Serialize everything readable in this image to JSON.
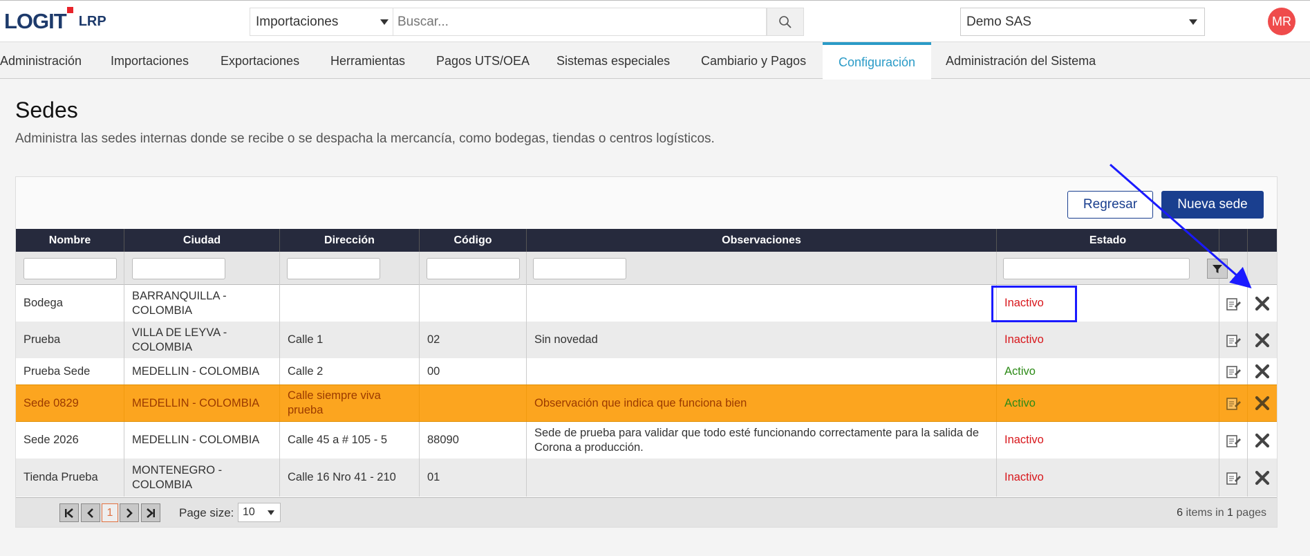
{
  "header": {
    "logo_text": "LOGIT",
    "logo_suffix": "LRP",
    "module_selected": "Importaciones",
    "search_placeholder": "Buscar...",
    "company_selected": "Demo SAS",
    "avatar_initials": "MR"
  },
  "nav": {
    "items": [
      {
        "label": "Administración"
      },
      {
        "label": "Importaciones"
      },
      {
        "label": "Exportaciones"
      },
      {
        "label": "Herramientas"
      },
      {
        "label": "Pagos UTS/OEA"
      },
      {
        "label": "Sistemas especiales"
      },
      {
        "label": "Cambiario y Pagos"
      },
      {
        "label": "Configuración",
        "active": true
      },
      {
        "label": "Administración del Sistema"
      }
    ]
  },
  "page": {
    "title": "Sedes",
    "description": "Administra las sedes internas donde se recibe o se despacha la mercancía, como bodegas, tiendas o centros logísticos."
  },
  "actions": {
    "back_label": "Regresar",
    "new_label": "Nueva sede"
  },
  "grid": {
    "columns": [
      "Nombre",
      "Ciudad",
      "Dirección",
      "Código",
      "Observaciones",
      "Estado"
    ],
    "rows": [
      {
        "nombre": "Bodega",
        "ciudad": "BARRANQUILLA - COLOMBIA",
        "direccion": "",
        "codigo": "",
        "observaciones": "",
        "estado": "Inactivo"
      },
      {
        "nombre": "Prueba",
        "ciudad": "VILLA DE LEYVA - COLOMBIA",
        "direccion": "Calle 1",
        "codigo": "02",
        "observaciones": "Sin novedad",
        "estado": "Inactivo"
      },
      {
        "nombre": "Prueba Sede",
        "ciudad": "MEDELLIN - COLOMBIA",
        "direccion": "Calle 2",
        "codigo": "00",
        "observaciones": "",
        "estado": "Activo"
      },
      {
        "nombre": "Sede 0829",
        "ciudad": "MEDELLIN - COLOMBIA",
        "direccion": "Calle siempre viva prueba",
        "codigo": "",
        "observaciones": "Observación que indica que funciona bien",
        "estado": "Activo",
        "selected": true
      },
      {
        "nombre": "Sede 2026",
        "ciudad": "MEDELLIN - COLOMBIA",
        "direccion": "Calle 45 a # 105 - 5",
        "codigo": "88090",
        "observaciones": "Sede de prueba para validar que todo esté funcionando correctamente para la salida de Corona a producción.",
        "estado": "Inactivo"
      },
      {
        "nombre": "Tienda Prueba",
        "ciudad": "MONTENEGRO - COLOMBIA",
        "direccion": "Calle 16 Nro 41 - 210",
        "codigo": "01",
        "observaciones": "",
        "estado": "Inactivo"
      }
    ]
  },
  "pager": {
    "current_page": "1",
    "page_size_label": "Page size:",
    "page_size": "10",
    "items_count": "6",
    "items_mid": "items in",
    "pages_count": "1",
    "pages_suffix": "pages"
  },
  "colors": {
    "brand": "#1d3a6b",
    "accent": "#2a9bc7",
    "primary_button": "#1a3f8f",
    "selected_row": "#fca51f",
    "inactive": "#d8161b",
    "active": "#2c8a16",
    "annotation": "#1a1aff"
  },
  "icons": {
    "search": "search-icon",
    "edit": "edit-icon",
    "delete": "delete-icon",
    "filter": "filter-icon"
  }
}
